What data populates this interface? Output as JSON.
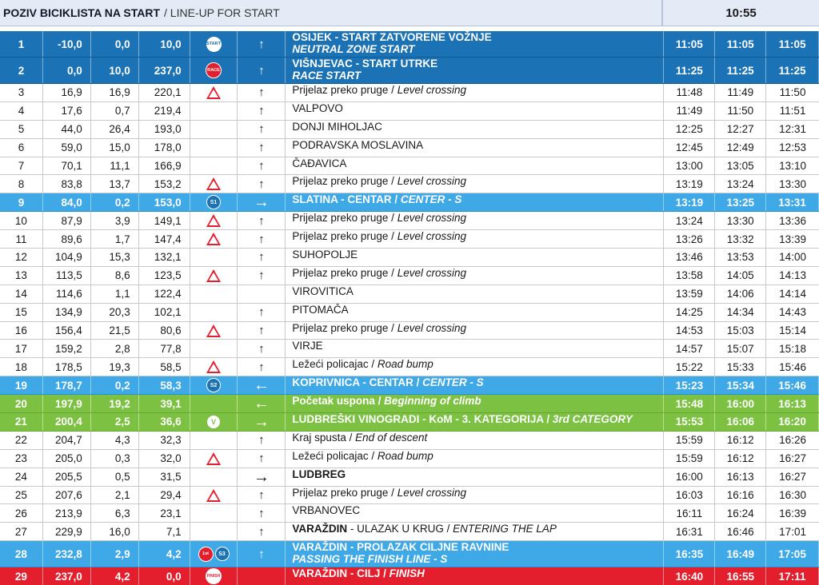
{
  "header": {
    "title": "POZIV BICIKLISTA NA START",
    "subtitle": "LINE-UP FOR START",
    "time": "10:55"
  },
  "rows": [
    {
      "no": "1",
      "km": "-10,0",
      "dist": "0,0",
      "rem": "10,0",
      "icon": "start-badge",
      "icon_text": "START",
      "dir": "↑",
      "style": "blue",
      "loc": "OSIJEK - START ZATVORENE VOŽNJE",
      "loc_en": "NEUTRAL ZONE START",
      "t1": "11:05",
      "t2": "11:05",
      "t3": "11:05"
    },
    {
      "no": "2",
      "km": "0,0",
      "dist": "10,0",
      "rem": "237,0",
      "icon": "race-badge",
      "icon_text": "RACE",
      "dir": "↑",
      "style": "blue",
      "loc": "VIŠNJEVAC - START UTRKE",
      "loc_en": "RACE START",
      "t1": "11:25",
      "t2": "11:25",
      "t3": "11:25"
    },
    {
      "no": "3",
      "km": "16,9",
      "dist": "16,9",
      "rem": "220,1",
      "icon": "level-crossing-icon",
      "dir": "↑",
      "style": "",
      "loc": "Prijelaz preko pruge",
      "loc_en": "Level crossing",
      "t1": "11:48",
      "t2": "11:49",
      "t3": "11:50"
    },
    {
      "no": "4",
      "km": "17,6",
      "dist": "0,7",
      "rem": "219,4",
      "icon": "",
      "dir": "↑",
      "style": "",
      "loc": "VALPOVO",
      "loc_en": "",
      "t1": "11:49",
      "t2": "11:50",
      "t3": "11:51"
    },
    {
      "no": "5",
      "km": "44,0",
      "dist": "26,4",
      "rem": "193,0",
      "icon": "",
      "dir": "↑",
      "style": "",
      "loc": "DONJI MIHOLJAC",
      "loc_en": "",
      "t1": "12:25",
      "t2": "12:27",
      "t3": "12:31"
    },
    {
      "no": "6",
      "km": "59,0",
      "dist": "15,0",
      "rem": "178,0",
      "icon": "",
      "dir": "↑",
      "style": "",
      "loc": "PODRAVSKA MOSLAVINA",
      "loc_en": "",
      "t1": "12:45",
      "t2": "12:49",
      "t3": "12:53"
    },
    {
      "no": "7",
      "km": "70,1",
      "dist": "11,1",
      "rem": "166,9",
      "icon": "",
      "dir": "↑",
      "style": "",
      "loc": "ČAĐAVICA",
      "loc_en": "",
      "t1": "13:00",
      "t2": "13:05",
      "t3": "13:10"
    },
    {
      "no": "8",
      "km": "83,8",
      "dist": "13,7",
      "rem": "153,2",
      "icon": "level-crossing-icon",
      "dir": "↑",
      "style": "",
      "loc": "Prijelaz preko pruge",
      "loc_en": "Level crossing",
      "t1": "13:19",
      "t2": "13:24",
      "t3": "13:30"
    },
    {
      "no": "9",
      "km": "84,0",
      "dist": "0,2",
      "rem": "153,0",
      "icon": "sprint-badge",
      "icon_text": "S1",
      "dir": "→",
      "style": "sky",
      "loc": "SLATINA - CENTAR",
      "loc_en": "CENTER - S",
      "t1": "13:19",
      "t2": "13:25",
      "t3": "13:31"
    },
    {
      "no": "10",
      "km": "87,9",
      "dist": "3,9",
      "rem": "149,1",
      "icon": "level-crossing-icon",
      "dir": "↑",
      "style": "",
      "loc": "Prijelaz preko pruge",
      "loc_en": "Level crossing",
      "t1": "13:24",
      "t2": "13:30",
      "t3": "13:36"
    },
    {
      "no": "11",
      "km": "89,6",
      "dist": "1,7",
      "rem": "147,4",
      "icon": "level-crossing-icon",
      "dir": "↑",
      "style": "",
      "loc": "Prijelaz preko pruge",
      "loc_en": "Level crossing",
      "t1": "13:26",
      "t2": "13:32",
      "t3": "13:39"
    },
    {
      "no": "12",
      "km": "104,9",
      "dist": "15,3",
      "rem": "132,1",
      "icon": "",
      "dir": "↑",
      "style": "",
      "loc": "SUHOPOLJE",
      "loc_en": "",
      "t1": "13:46",
      "t2": "13:53",
      "t3": "14:00"
    },
    {
      "no": "13",
      "km": "113,5",
      "dist": "8,6",
      "rem": "123,5",
      "icon": "level-crossing-icon",
      "dir": "↑",
      "style": "",
      "loc": "Prijelaz preko pruge",
      "loc_en": "Level crossing",
      "t1": "13:58",
      "t2": "14:05",
      "t3": "14:13"
    },
    {
      "no": "14",
      "km": "114,6",
      "dist": "1,1",
      "rem": "122,4",
      "icon": "",
      "dir": "",
      "style": "",
      "loc": "VIROVITICA",
      "loc_en": "",
      "t1": "13:59",
      "t2": "14:06",
      "t3": "14:14"
    },
    {
      "no": "15",
      "km": "134,9",
      "dist": "20,3",
      "rem": "102,1",
      "icon": "",
      "dir": "↑",
      "style": "",
      "loc": "PITOMAČA",
      "loc_en": "",
      "t1": "14:25",
      "t2": "14:34",
      "t3": "14:43"
    },
    {
      "no": "16",
      "km": "156,4",
      "dist": "21,5",
      "rem": "80,6",
      "icon": "level-crossing-icon",
      "dir": "↑",
      "style": "",
      "loc": "Prijelaz preko pruge",
      "loc_en": "Level crossing",
      "t1": "14:53",
      "t2": "15:03",
      "t3": "15:14"
    },
    {
      "no": "17",
      "km": "159,2",
      "dist": "2,8",
      "rem": "77,8",
      "icon": "",
      "dir": "↑",
      "style": "",
      "loc": "VIRJE",
      "loc_en": "",
      "t1": "14:57",
      "t2": "15:07",
      "t3": "15:18"
    },
    {
      "no": "18",
      "km": "178,5",
      "dist": "19,3",
      "rem": "58,5",
      "icon": "road-bump-icon",
      "dir": "↑",
      "style": "",
      "loc": "Ležeći policajac",
      "loc_en": "Road bump",
      "t1": "15:22",
      "t2": "15:33",
      "t3": "15:46"
    },
    {
      "no": "19",
      "km": "178,7",
      "dist": "0,2",
      "rem": "58,3",
      "icon": "sprint-badge",
      "icon_text": "S2",
      "dir": "←",
      "style": "sky",
      "loc": "KOPRIVNICA - CENTAR",
      "loc_en": "CENTER - S",
      "t1": "15:23",
      "t2": "15:34",
      "t3": "15:46"
    },
    {
      "no": "20",
      "km": "197,9",
      "dist": "19,2",
      "rem": "39,1",
      "icon": "",
      "dir": "←",
      "style": "lime",
      "loc": "Početak uspona",
      "loc_en": "Beginning of climb",
      "t1": "15:48",
      "t2": "16:00",
      "t3": "16:13"
    },
    {
      "no": "21",
      "km": "200,4",
      "dist": "2,5",
      "rem": "36,6",
      "icon": "kom-badge",
      "icon_text": "V",
      "dir": "→",
      "style": "lime",
      "loc": "LUDBREŠKI VINOGRADI - KoM - 3. KATEGORIJA",
      "loc_en": "3rd CATEGORY",
      "t1": "15:53",
      "t2": "16:06",
      "t3": "16:20"
    },
    {
      "no": "22",
      "km": "204,7",
      "dist": "4,3",
      "rem": "32,3",
      "icon": "",
      "dir": "↑",
      "style": "",
      "loc": "Kraj spusta",
      "loc_en": "End of descent",
      "t1": "15:59",
      "t2": "16:12",
      "t3": "16:26"
    },
    {
      "no": "23",
      "km": "205,0",
      "dist": "0,3",
      "rem": "32,0",
      "icon": "road-bump-icon",
      "dir": "↑",
      "style": "",
      "loc": "Ležeći policajac",
      "loc_en": "Road bump",
      "t1": "15:59",
      "t2": "16:12",
      "t3": "16:27"
    },
    {
      "no": "24",
      "km": "205,5",
      "dist": "0,5",
      "rem": "31,5",
      "icon": "",
      "dir": "→",
      "style": "",
      "loc": "LUDBREG",
      "loc_en": "",
      "bold": true,
      "t1": "16:00",
      "t2": "16:13",
      "t3": "16:27"
    },
    {
      "no": "25",
      "km": "207,6",
      "dist": "2,1",
      "rem": "29,4",
      "icon": "level-crossing-icon",
      "dir": "↑",
      "style": "",
      "loc": "Prijelaz preko pruge",
      "loc_en": "Level crossing",
      "t1": "16:03",
      "t2": "16:16",
      "t3": "16:30"
    },
    {
      "no": "26",
      "km": "213,9",
      "dist": "6,3",
      "rem": "23,1",
      "icon": "",
      "dir": "↑",
      "style": "",
      "loc": "VRBANOVEC",
      "loc_en": "",
      "t1": "16:11",
      "t2": "16:24",
      "t3": "16:39"
    },
    {
      "no": "27",
      "km": "229,9",
      "dist": "16,0",
      "rem": "7,1",
      "icon": "",
      "dir": "↑",
      "style": "",
      "loc": "VARAŽDIN",
      "loc_mid": "ULAZAK U KRUG",
      "loc_en": "ENTERING THE LAP",
      "bold": true,
      "t1": "16:31",
      "t2": "16:46",
      "t3": "17:01"
    },
    {
      "no": "28",
      "km": "232,8",
      "dist": "2,9",
      "rem": "4,2",
      "icon": "finish-line-sprint-badges",
      "icon_text": "1st",
      "icon_text2": "S3",
      "dir": "↑",
      "style": "sky",
      "loc": "VARAŽDIN - PROLAZAK CILJNE RAVNINE",
      "loc_en": "PASSING THE FINISH LINE - S",
      "t1": "16:35",
      "t2": "16:49",
      "t3": "17:05"
    },
    {
      "no": "29",
      "km": "237,0",
      "dist": "4,2",
      "rem": "0,0",
      "icon": "finish-badge",
      "icon_text": "FINISH",
      "dir": "",
      "style": "red",
      "loc": "VARAŽDIN - CILJ",
      "loc_en": "FINISH",
      "t1": "16:40",
      "t2": "16:55",
      "t3": "17:11"
    }
  ],
  "colors": {
    "blue": "#1b72b4",
    "sky": "#3fa8e6",
    "lime": "#7dc142",
    "red": "#e31e2d"
  }
}
